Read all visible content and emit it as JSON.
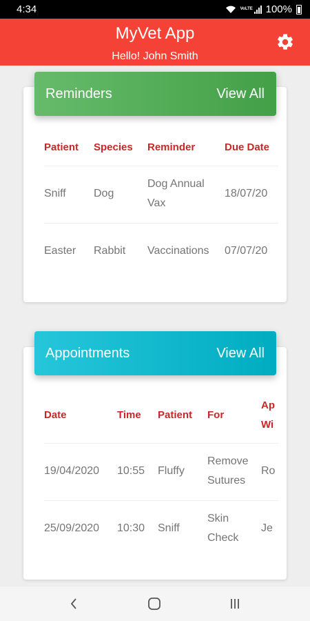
{
  "status_bar": {
    "time": "4:34",
    "battery": "100%",
    "network": "VoLTE"
  },
  "app_bar": {
    "title": "MyVet App",
    "greeting": "Hello! John Smith",
    "settings_icon": "gear-icon"
  },
  "reminders": {
    "title": "Reminders",
    "view_all": "View All",
    "header_color": "#4caf50",
    "columns": [
      "Patient",
      "Species",
      "Reminder",
      "Due Date"
    ],
    "rows": [
      [
        "Sniff",
        "Dog",
        "Dog Annual Vax",
        "18/07/20"
      ],
      [
        "Easter",
        "Rabbit",
        "Vaccinations",
        "07/07/20"
      ]
    ]
  },
  "appointments": {
    "title": "Appointments",
    "view_all": "View All",
    "header_color": "#00bcd4",
    "columns": [
      "Date",
      "Time",
      "Patient",
      "For",
      "Ap Wi"
    ],
    "rows": [
      [
        "19/04/2020",
        "10:55",
        "Fluffy",
        "Remove Sutures",
        "Ro"
      ],
      [
        "25/09/2020",
        "10:30",
        "Sniff",
        "Skin Check",
        "Je"
      ]
    ]
  },
  "nav_bar": {
    "back_icon": "back-icon",
    "home_icon": "home-icon",
    "recents_icon": "recents-icon"
  },
  "colors": {
    "appbar": "#f44336",
    "table_header_text": "#c62828",
    "background": "#eeeeee"
  }
}
